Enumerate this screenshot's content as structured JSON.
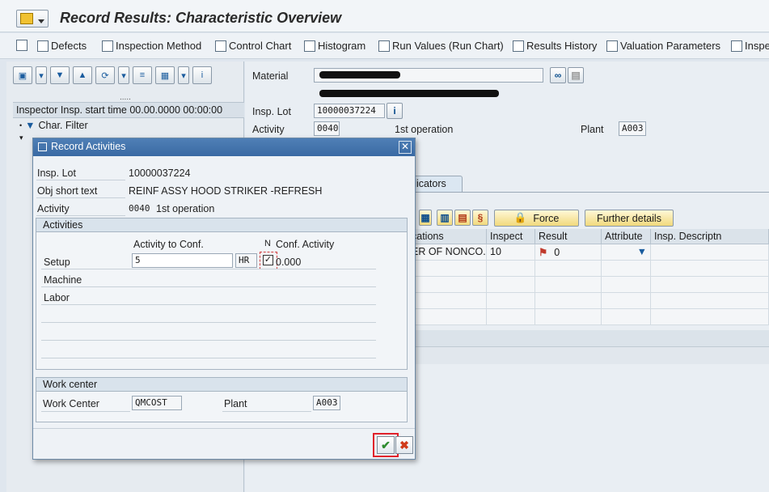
{
  "title": "Record Results: Characteristic Overview",
  "app_toolbar": [
    {
      "label": "Defects",
      "icon": "document-icon"
    },
    {
      "label": "Inspection Method",
      "icon": "inspection-method-icon"
    },
    {
      "label": "Control Chart",
      "icon": "control-chart-icon"
    },
    {
      "label": "Histogram",
      "icon": "histogram-icon"
    },
    {
      "label": "Run Values (Run Chart)",
      "icon": "run-chart-icon"
    },
    {
      "label": "Results History",
      "icon": "results-history-icon"
    },
    {
      "label": "Valuation Parameters",
      "icon": "valuation-icon"
    },
    {
      "label": "Inspe",
      "icon": "inspector-icon"
    }
  ],
  "left": {
    "tree_header": "Inspector Insp. start time 00.00.0000 00:00:00",
    "dots": ".....",
    "char_filter": "Char. Filter"
  },
  "header": {
    "material_label": "Material",
    "insp_lot_label": "Insp. Lot",
    "insp_lot_value": "10000037224",
    "activity_label": "Activity",
    "activity_value": "0040",
    "activity_text": "1st operation",
    "plant_label": "Plant",
    "plant_value": "A003"
  },
  "tab_label": "dicators",
  "buttons": {
    "force": "Force",
    "further": "Further details"
  },
  "grid": {
    "columns": [
      "cations",
      "Inspect",
      "Result",
      "Attribute",
      "Insp. Descriptn"
    ],
    "rows": [
      [
        "ER OF NONCO...",
        "10",
        "0",
        "",
        ""
      ]
    ]
  },
  "dialog": {
    "title": "Record Activities",
    "insp_lot_label": "Insp. Lot",
    "insp_lot_value": "10000037224",
    "obj_label": "Obj short text",
    "obj_value": "REINF ASSY HOOD STRIKER -REFRESH",
    "activity_label": "Activity",
    "activity_value": "0040",
    "activity_text": "1st operation",
    "activities_group": "Activities",
    "col_activity_to_conf": "Activity to Conf.",
    "col_n": "N",
    "col_conf_activity": "Conf. Activity",
    "setup_label": "Setup",
    "setup_value": "5",
    "setup_unit": "HR",
    "setup_conf": "0.000",
    "machine_label": "Machine",
    "labor_label": "Labor",
    "workcenter_group": "Work center",
    "workcenter_label": "Work Center",
    "workcenter_value": "QMCOST",
    "plant_label": "Plant",
    "plant_value": "A003"
  },
  "colors": {
    "accent": "#3a6aa3",
    "highlight": "#e0202a"
  }
}
